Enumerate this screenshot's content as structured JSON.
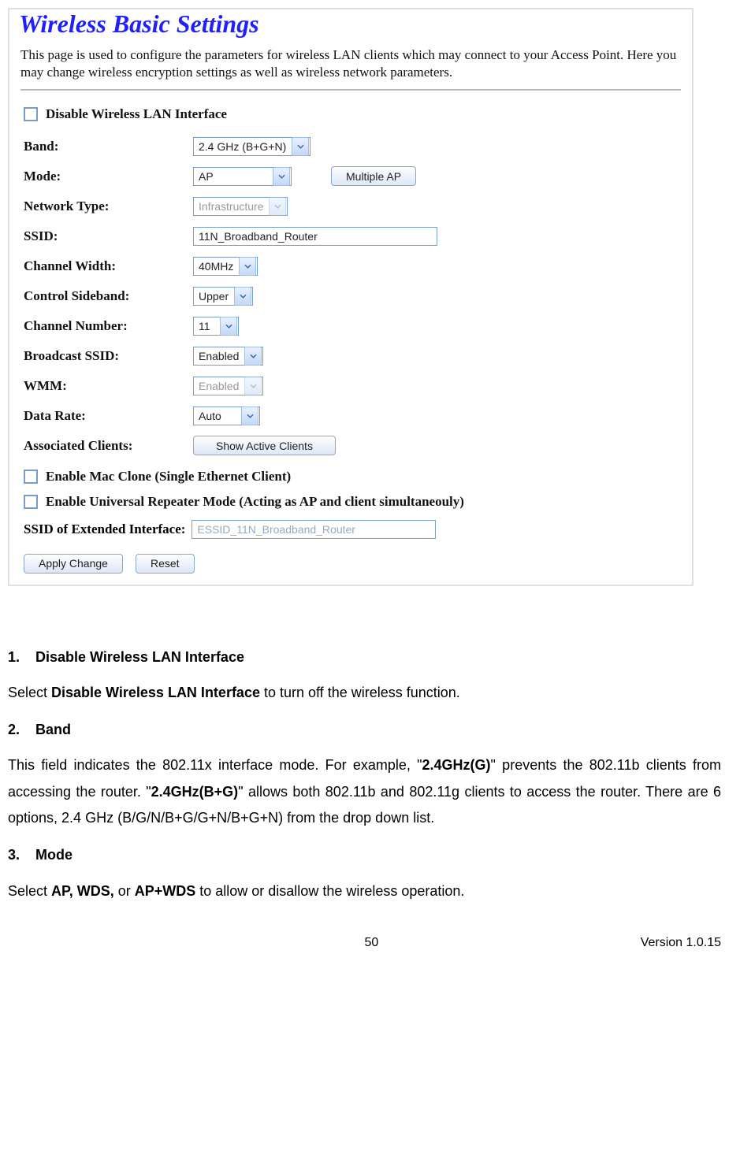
{
  "panel": {
    "title": "Wireless Basic Settings",
    "description": "This page is used to configure the parameters for wireless LAN clients which may connect to your Access Point. Here you may change wireless encryption settings as well as wireless network parameters.",
    "disable_label": "Disable Wireless LAN Interface",
    "rows": {
      "band": {
        "label": "Band:",
        "value": "2.4 GHz (B+G+N)"
      },
      "mode": {
        "label": "Mode:",
        "value": "AP",
        "button": "Multiple AP"
      },
      "network_type": {
        "label": "Network Type:",
        "value": "Infrastructure"
      },
      "ssid": {
        "label": "SSID:",
        "value": "11N_Broadband_Router"
      },
      "channel_width": {
        "label": "Channel Width:",
        "value": "40MHz"
      },
      "sideband": {
        "label": "Control Sideband:",
        "value": "Upper"
      },
      "channel_num": {
        "label": "Channel Number:",
        "value": "11"
      },
      "broadcast": {
        "label": "Broadcast SSID:",
        "value": "Enabled"
      },
      "wmm": {
        "label": "WMM:",
        "value": "Enabled"
      },
      "datarate": {
        "label": "Data Rate:",
        "value": "Auto"
      },
      "assoc": {
        "label": "Associated Clients:",
        "button": "Show Active Clients"
      }
    },
    "mac_clone_label": "Enable Mac Clone (Single Ethernet Client)",
    "repeater_label": "Enable Universal Repeater Mode (Acting as AP and client simultaneouly)",
    "ext_ssid_label": "SSID of Extended Interface:",
    "ext_ssid_placeholder": "ESSID_11N_Broadband_Router",
    "apply_label": "Apply Change",
    "reset_label": "Reset"
  },
  "doc": {
    "h1_num": "1.",
    "h1_title": "Disable Wireless LAN Interface",
    "p1_a": "Select ",
    "p1_b": "Disable Wireless LAN Interface",
    "p1_c": " to turn off the wireless function.",
    "h2_num": "2.",
    "h2_title": "Band",
    "p2_a": "This field indicates the 802.11x interface mode. For example, \"",
    "p2_b": "2.4GHz(G)",
    "p2_c": "\" prevents the 802.11b clients from accessing the router. \"",
    "p2_d": "2.4GHz(B+G)",
    "p2_e": "\" allows both 802.11b and 802.11g clients to access the router. There are 6 options, 2.4 GHz (B/G/N/B+G/G+N/B+G+N) from the drop down list.",
    "h3_num": "3.",
    "h3_title": "Mode",
    "p3_a": "Select ",
    "p3_b": "AP, WDS,",
    "p3_c": " or ",
    "p3_d": "AP+WDS",
    "p3_e": " to allow or disallow the wireless operation."
  },
  "footer": {
    "page": "50",
    "version": "Version 1.0.15"
  }
}
